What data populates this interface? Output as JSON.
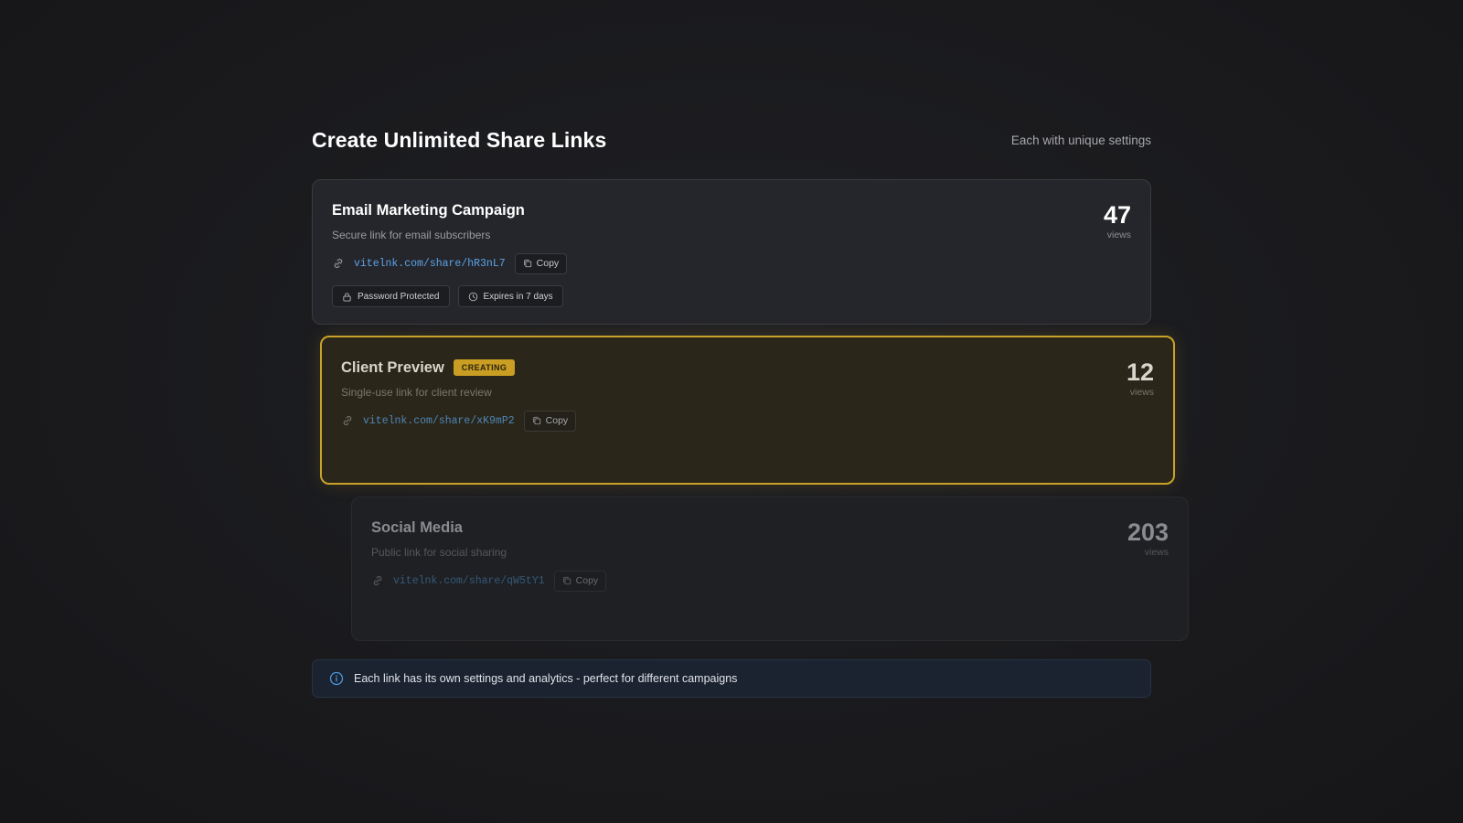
{
  "header": {
    "title": "Create Unlimited Share Links",
    "subtitle": "Each with unique settings"
  },
  "cards": [
    {
      "title": "Email Marketing Campaign",
      "description": "Secure link for email subscribers",
      "url": "vitelnk.com/share/hR3nL7",
      "copy_label": "Copy",
      "views": "47",
      "views_label": "views",
      "tags": [
        "Password Protected",
        "Expires in 7 days"
      ]
    },
    {
      "title": "Client Preview",
      "badge": "CREATING",
      "description": "Single-use link for client review",
      "url": "vitelnk.com/share/xK9mP2",
      "copy_label": "Copy",
      "views": "12",
      "views_label": "views"
    },
    {
      "title": "Social Media",
      "description": "Public link for social sharing",
      "url": "vitelnk.com/share/qW5tY1",
      "copy_label": "Copy",
      "views": "203",
      "views_label": "views"
    }
  ],
  "info": {
    "text": "Each link has its own settings and analytics - perfect for different campaigns"
  },
  "colors": {
    "accent_gold": "#c9a227",
    "link_blue": "#5aa3e6",
    "background": "#1a1b1f"
  },
  "icons": [
    "link-icon",
    "copy-icon",
    "lock-icon",
    "clock-icon",
    "info-icon"
  ]
}
